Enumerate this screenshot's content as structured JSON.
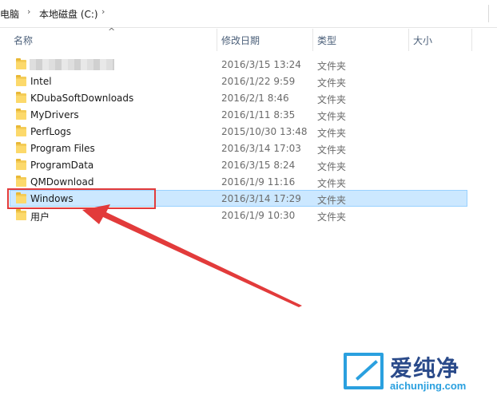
{
  "breadcrumb": {
    "items": [
      "电脑",
      "本地磁盘 (C:)"
    ],
    "separator": "›"
  },
  "columns": {
    "name": "名称",
    "date": "修改日期",
    "type": "类型",
    "size": "大小"
  },
  "rows": [
    {
      "name": "",
      "date": "2016/3/15 13:24",
      "type": "文件夹",
      "blurred": true
    },
    {
      "name": "Intel",
      "date": "2016/1/22 9:59",
      "type": "文件夹"
    },
    {
      "name": "KDubaSoftDownloads",
      "date": "2016/2/1 8:46",
      "type": "文件夹"
    },
    {
      "name": "MyDrivers",
      "date": "2016/1/11 8:35",
      "type": "文件夹"
    },
    {
      "name": "PerfLogs",
      "date": "2015/10/30 13:48",
      "type": "文件夹"
    },
    {
      "name": "Program Files",
      "date": "2016/3/14 17:03",
      "type": "文件夹"
    },
    {
      "name": "ProgramData",
      "date": "2016/3/15 8:24",
      "type": "文件夹"
    },
    {
      "name": "QMDownload",
      "date": "2016/1/9 11:16",
      "type": "文件夹"
    },
    {
      "name": "Windows",
      "date": "2016/3/14 17:29",
      "type": "文件夹",
      "selected": true
    },
    {
      "name": "用户",
      "date": "2016/1/9 10:30",
      "type": "文件夹"
    }
  ],
  "icons": {
    "folder": "folder-icon",
    "sort": "sort-up-icon",
    "chevron": "chevron-right-icon"
  },
  "colors": {
    "selection_bg": "#cce8ff",
    "selection_border": "#99d1ff",
    "annotation": "#e23b3b",
    "folder": "#f4cc57",
    "watermark_blue": "#2aa0df",
    "watermark_dark": "#2a4a8a"
  },
  "watermark": {
    "title": "爱纯净",
    "site": "aichunjing.com"
  }
}
